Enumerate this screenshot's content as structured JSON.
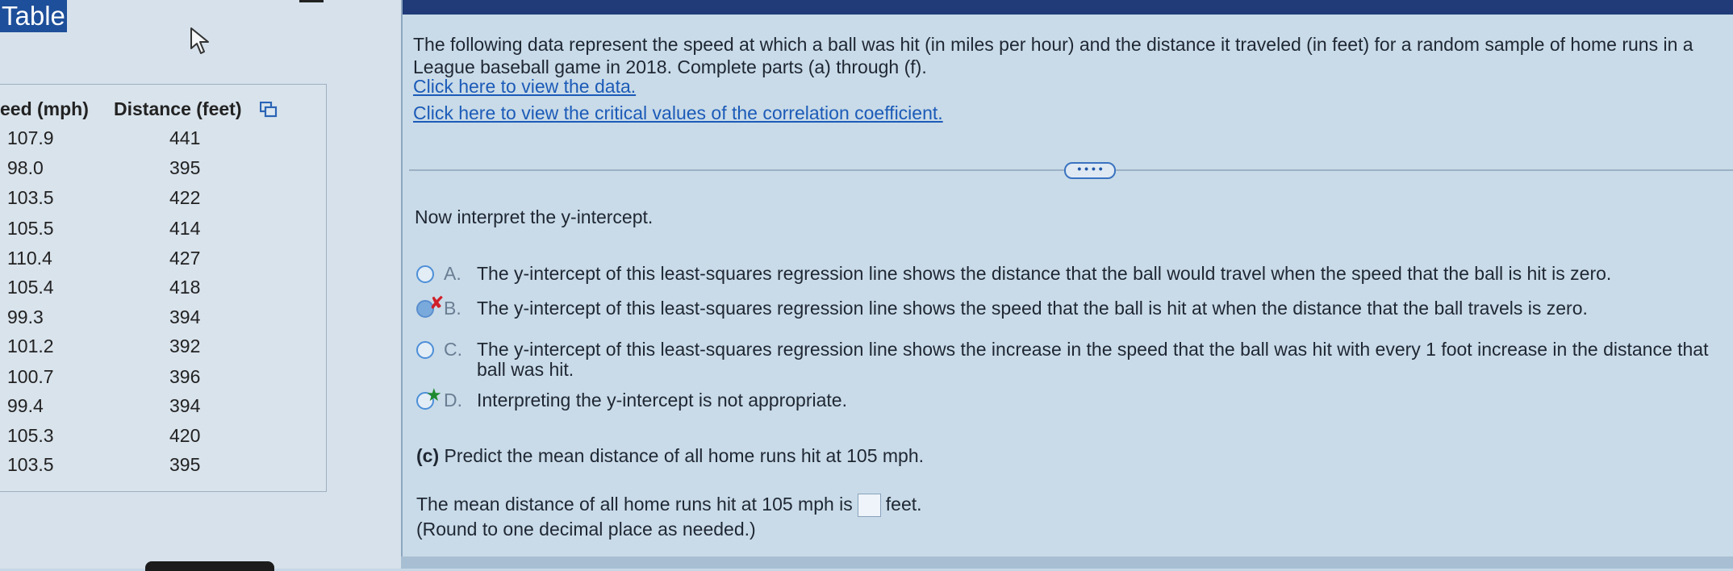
{
  "left_panel": {
    "title": "Table",
    "columns": [
      "eed (mph)",
      "Distance (feet)"
    ],
    "rows": [
      {
        "speed": "107.9",
        "distance": "441"
      },
      {
        "speed": "98.0",
        "distance": "395"
      },
      {
        "speed": "103.5",
        "distance": "422"
      },
      {
        "speed": "105.5",
        "distance": "414"
      },
      {
        "speed": "110.4",
        "distance": "427"
      },
      {
        "speed": "105.4",
        "distance": "418"
      },
      {
        "speed": "99.3",
        "distance": "394"
      },
      {
        "speed": "101.2",
        "distance": "392"
      },
      {
        "speed": "100.7",
        "distance": "396"
      },
      {
        "speed": "99.4",
        "distance": "394"
      },
      {
        "speed": "105.3",
        "distance": "420"
      },
      {
        "speed": "103.5",
        "distance": "395"
      }
    ],
    "copy_icon": "copy-icon",
    "cursor_icon": "pointer-cursor-icon"
  },
  "question": {
    "intro_line1": "The following data represent the speed at which a ball was hit (in miles per hour) and the distance it traveled (in feet) for a random sample of home runs in a",
    "intro_line2": "League baseball game in 2018. Complete parts (a) through (f).",
    "link_data": "Click here to view the data.",
    "link_critical": "Click here to view the critical values of the correlation coefficient.",
    "expand_label": "• • • •",
    "prompt": "Now interpret the y-intercept.",
    "options": [
      {
        "letter": "A.",
        "text": "The y-intercept of this least-squares regression line shows the distance that the ball would travel when the speed that the ball is hit is zero.",
        "selected": false,
        "mark": ""
      },
      {
        "letter": "B.",
        "text": "The y-intercept of this least-squares regression line shows the speed that the ball is hit at when the distance that the ball travels is zero.",
        "selected": true,
        "mark": "✘"
      },
      {
        "letter": "C.",
        "text": "The y-intercept of this least-squares regression line shows the increase in the speed that the ball was hit with every 1 foot increase in the distance that",
        "text2": "ball was hit.",
        "selected": false,
        "mark": ""
      },
      {
        "letter": "D.",
        "text": "Interpreting the y-intercept is not appropriate.",
        "selected": false,
        "mark": "★"
      }
    ],
    "part_c_label": "(c)",
    "part_c_text": "Predict the mean distance of all home runs hit at 105 mph.",
    "answer_prefix": "The mean distance of all home runs hit at 105 mph is",
    "answer_value": "",
    "answer_suffix": "feet.",
    "round_note": "(Round to one decimal place as needed.)"
  },
  "colors": {
    "title_bar": "#1e4f9a",
    "link": "#1c5bb8",
    "wrong_mark": "#d0202a",
    "correct_mark": "#1e8a2e",
    "radio_border": "#4d8fd8"
  }
}
